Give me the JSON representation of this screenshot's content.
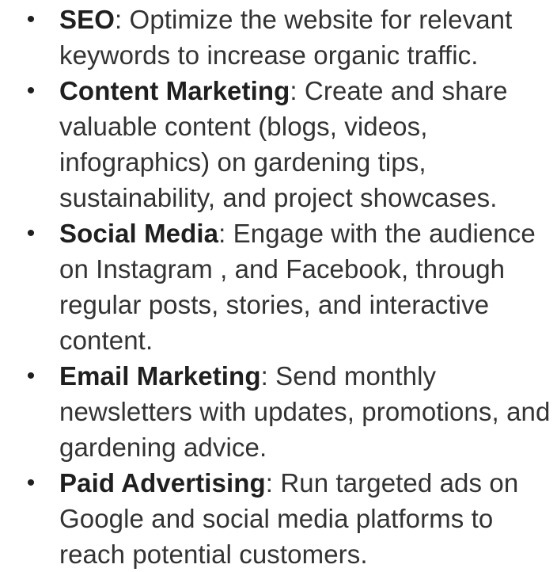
{
  "items": [
    {
      "bullet": "•",
      "term": "SEO",
      "separator": ":",
      "description": " Optimize the website for relevant keywords to increase organic traffic."
    },
    {
      "bullet": "•",
      "term": "Content Marketing",
      "separator": ":",
      "description": " Create and share valuable content (blogs, videos, infographics) on gardening tips, sustainability, and project showcases."
    },
    {
      "bullet": "•",
      "term": "Social Media",
      "separator": ":",
      "description": " Engage with the audience on Instagram , and Facebook, through regular posts, stories, and interactive content."
    },
    {
      "bullet": "•",
      "term": "Email Marketing",
      "separator": ":",
      "description": " Send monthly newsletters with updates, promotions, and gardening advice."
    },
    {
      "bullet": "•",
      "term": "Paid Advertising",
      "separator": ":",
      "description": " Run targeted ads on Google and social media platforms to reach potential customers."
    }
  ]
}
